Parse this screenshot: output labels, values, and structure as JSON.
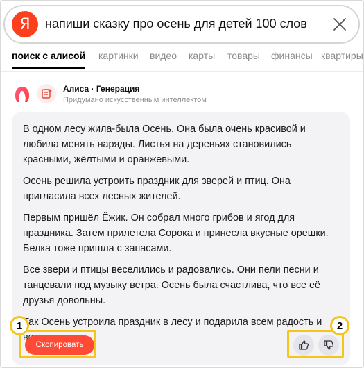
{
  "search": {
    "logo_letter": "Я",
    "query": "напиши сказку про осень для детей 100 слов"
  },
  "tabs": [
    {
      "label": "поиск с алисой",
      "active": true
    },
    {
      "label": "картинки"
    },
    {
      "label": "видео"
    },
    {
      "label": "карты"
    },
    {
      "label": "товары"
    },
    {
      "label": "финансы"
    },
    {
      "label": "квартиры"
    }
  ],
  "answer": {
    "title": "Алиса · Генерация",
    "subtitle": "Придумано искусственным интеллектом",
    "paragraphs": [
      "В одном лесу жила-была Осень. Она была очень красивой и любила менять наряды. Листья на деревьях становились красными, жёлтыми и оранжевыми.",
      "Осень решила устроить праздник для зверей и птиц. Она пригласила всех лесных жителей.",
      "Первым пришёл Ёжик. Он собрал много грибов и ягод для праздника. Затем прилетела Сорока и принесла вкусные орешки. Белка тоже пришла с запасами.",
      "Все звери и птицы веселились и радовались. Они пели песни и танцевали под музыку ветра. Осень была счастлива, что все её друзья довольны.",
      "Так Осень устроила праздник в лесу и подарила всем радость и веселье."
    ],
    "copy_label": "Скопировать"
  },
  "callouts": [
    "1",
    "2"
  ],
  "colors": {
    "brand": "#fc3f1d",
    "copy_button": "#ff4a36",
    "callout": "#f5c518"
  },
  "icons": [
    "yandex-logo",
    "clear-icon",
    "alice-icon",
    "generation-icon",
    "thumbs-up-icon",
    "thumbs-down-icon"
  ]
}
